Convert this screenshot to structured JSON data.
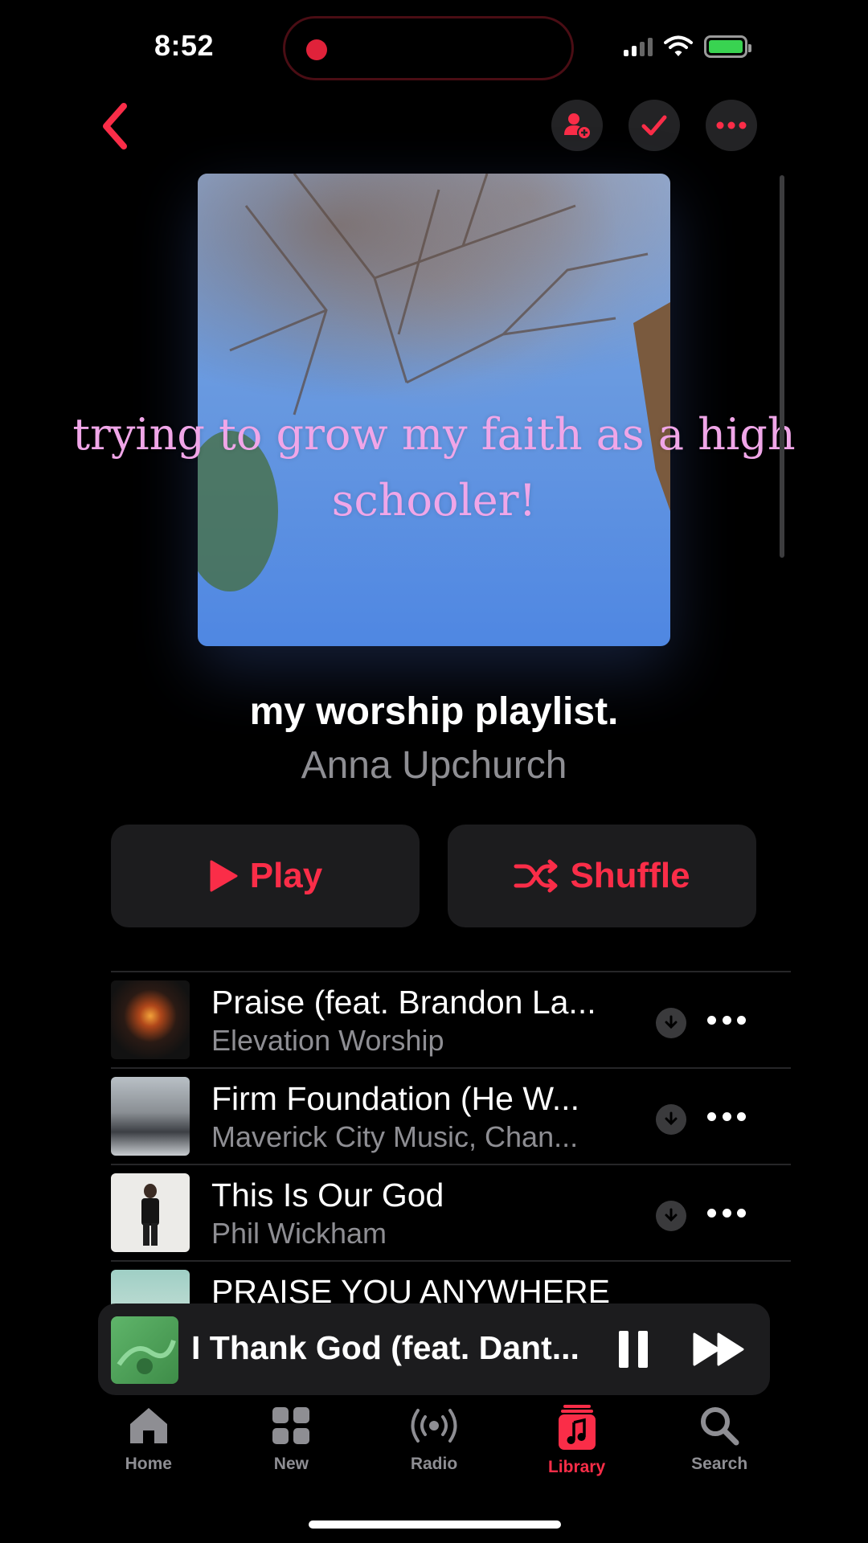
{
  "status_bar": {
    "time": "8:52",
    "recording": true
  },
  "colors": {
    "accent": "#fa2d48",
    "background": "#000000",
    "secondary_text": "#8e8e93",
    "battery": "#39d351"
  },
  "header": {
    "icons": [
      "back-chevron-icon",
      "add-person-icon",
      "checkmark-icon",
      "ellipsis-icon"
    ]
  },
  "artwork": {
    "caption": "trying to grow my faith as a high schooler!"
  },
  "playlist": {
    "title": "my worship playlist.",
    "owner": "Anna Upchurch"
  },
  "actions": {
    "play_label": "Play",
    "shuffle_label": "Shuffle"
  },
  "songs": [
    {
      "title": "Praise (feat. Brandon La...",
      "artist": "Elevation Worship"
    },
    {
      "title": "Firm Foundation (He W...",
      "artist": "Maverick City Music, Chan..."
    },
    {
      "title": "This Is Our God",
      "artist": "Phil Wickham"
    },
    {
      "title": "PRAISE YOU ANYWHERE",
      "artist": ""
    }
  ],
  "now_playing": {
    "title": "I Thank God (feat. Dant..."
  },
  "tabs": [
    {
      "label": "Home",
      "icon": "house-icon"
    },
    {
      "label": "New",
      "icon": "grid-icon"
    },
    {
      "label": "Radio",
      "icon": "broadcast-icon"
    },
    {
      "label": "Library",
      "icon": "music-note-icon",
      "active": true
    },
    {
      "label": "Search",
      "icon": "magnifier-icon"
    }
  ]
}
